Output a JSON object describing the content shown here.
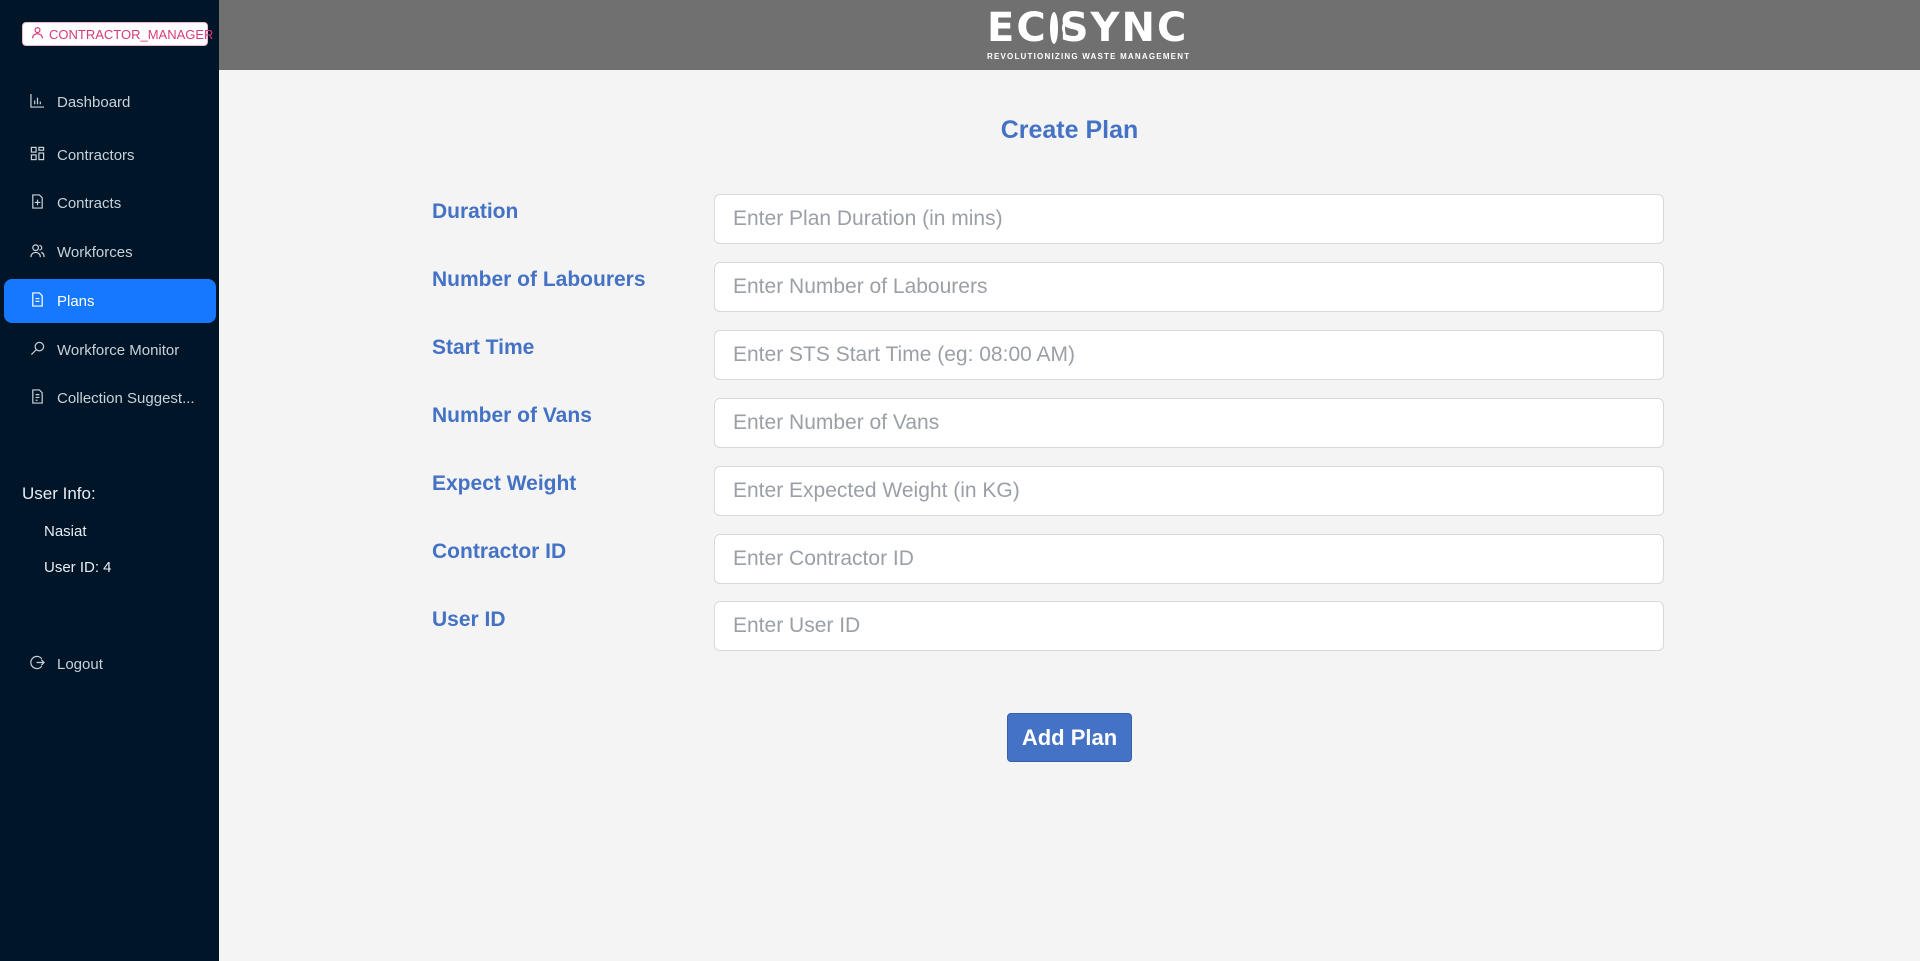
{
  "sidebar": {
    "role_badge": "CONTRACTOR_MANAGER",
    "items": [
      {
        "label": "Dashboard",
        "icon": "chart-icon"
      },
      {
        "label": "Contractors",
        "icon": "grid-icon"
      },
      {
        "label": "Contracts",
        "icon": "file-add-icon"
      },
      {
        "label": "Workforces",
        "icon": "team-icon"
      },
      {
        "label": "Plans",
        "icon": "file-icon",
        "active": true
      },
      {
        "label": "Workforce Monitor",
        "icon": "search-icon"
      },
      {
        "label": "Collection Suggest...",
        "icon": "file-list-icon"
      }
    ],
    "user_info_title": "User Info:",
    "user_name": "Nasiat",
    "user_id": "User ID: 4",
    "logout_label": "Logout"
  },
  "header": {
    "logo_left": "EC",
    "logo_right": "SYNC",
    "logo_tagline": "REVOLUTIONIZING WASTE MANAGEMENT"
  },
  "form": {
    "title": "Create Plan",
    "fields": [
      {
        "label": "Duration",
        "placeholder": "Enter Plan Duration (in mins)",
        "value": ""
      },
      {
        "label": "Number of Labourers",
        "placeholder": "Enter Number of Labourers",
        "value": ""
      },
      {
        "label": "Start Time",
        "placeholder": "Enter STS Start Time (eg: 08:00 AM)",
        "value": ""
      },
      {
        "label": "Number of Vans",
        "placeholder": "Enter Number of Vans",
        "value": ""
      },
      {
        "label": "Expect Weight",
        "placeholder": "Enter Expected Weight (in KG)",
        "value": ""
      },
      {
        "label": "Contractor ID",
        "placeholder": "Enter Contractor ID",
        "value": ""
      },
      {
        "label": "User ID",
        "placeholder": "Enter User ID",
        "value": ""
      }
    ],
    "submit_label": "Add Plan"
  },
  "colors": {
    "sidebar_bg": "#011528",
    "active_item": "#1677ff",
    "accent": "#4472c4",
    "header_bg": "#707070",
    "role_badge_text": "#d63a78"
  }
}
